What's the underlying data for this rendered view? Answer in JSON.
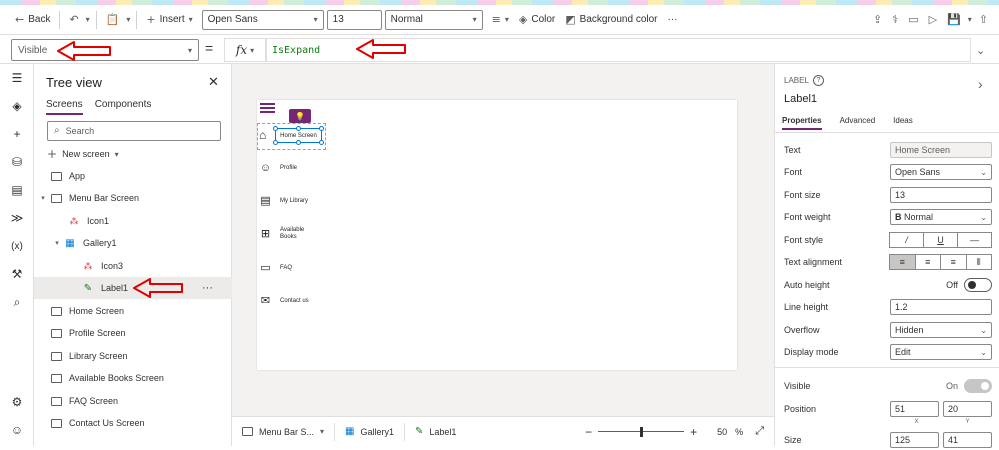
{
  "toolbar": {
    "back_label": "Back",
    "insert_label": "Insert",
    "font_family": "Open Sans",
    "font_size": "13",
    "font_weight": "Normal",
    "color_label": "Color",
    "background_color_label": "Background color",
    "more_label": "···"
  },
  "formula_bar": {
    "property": "Visible",
    "equals": "=",
    "fx_label": "fx",
    "formula": "IsExpand"
  },
  "tree_view": {
    "title": "Tree view",
    "tabs": [
      "Screens",
      "Components"
    ],
    "search_placeholder": "Search",
    "new_screen_label": "New screen",
    "items": [
      {
        "label": "App"
      },
      {
        "label": "Menu Bar Screen"
      },
      {
        "label": "Icon1"
      },
      {
        "label": "Gallery1"
      },
      {
        "label": "Icon3"
      },
      {
        "label": "Label1"
      },
      {
        "label": "Home Screen"
      },
      {
        "label": "Profile Screen"
      },
      {
        "label": "Library Screen"
      },
      {
        "label": "Available Books Screen"
      },
      {
        "label": "FAQ Screen"
      },
      {
        "label": "Contact Us Screen"
      }
    ],
    "selected_more": "···"
  },
  "canvas": {
    "selected_label_text": "Home Screen",
    "menu": [
      {
        "label": "Profile",
        "icon": "person-icon"
      },
      {
        "label": "My Library",
        "icon": "book-icon"
      },
      {
        "label": "Available\nBooks",
        "icon": "add-box-icon"
      },
      {
        "label": "FAQ",
        "icon": "chat-icon"
      },
      {
        "label": "Contact us",
        "icon": "mail-icon"
      }
    ]
  },
  "statusbar": {
    "crumbs": [
      "Menu Bar S...",
      "Gallery1",
      "Label1"
    ],
    "zoom_value": "50",
    "zoom_unit": "%",
    "zoom_level": 0.5
  },
  "properties": {
    "type_label": "LABEL",
    "control_name": "Label1",
    "tabs": [
      "Properties",
      "Advanced",
      "Ideas"
    ],
    "rows": {
      "text": {
        "label": "Text",
        "value": "Home Screen"
      },
      "font": {
        "label": "Font",
        "value": "Open Sans"
      },
      "font_size": {
        "label": "Font size",
        "value": "13"
      },
      "font_weight": {
        "label": "Font weight",
        "value": "Normal"
      },
      "font_style": {
        "label": "Font style",
        "buttons": [
          "/",
          "U",
          "—"
        ]
      },
      "text_alignment": {
        "label": "Text alignment"
      },
      "auto_height": {
        "label": "Auto height",
        "value": "Off"
      },
      "line_height": {
        "label": "Line height",
        "value": "1.2"
      },
      "overflow": {
        "label": "Overflow",
        "value": "Hidden"
      },
      "display_mode": {
        "label": "Display mode",
        "value": "Edit"
      },
      "visible": {
        "label": "Visible",
        "value": "On"
      },
      "position": {
        "label": "Position",
        "x": "51",
        "y": "20",
        "x_label": "X",
        "y_label": "Y"
      },
      "size": {
        "label": "Size",
        "width": "125",
        "height": "41"
      }
    }
  },
  "colors": {
    "accent": "#742774",
    "annotation_arrow": "#e00000",
    "formula_text": "#107c10"
  }
}
